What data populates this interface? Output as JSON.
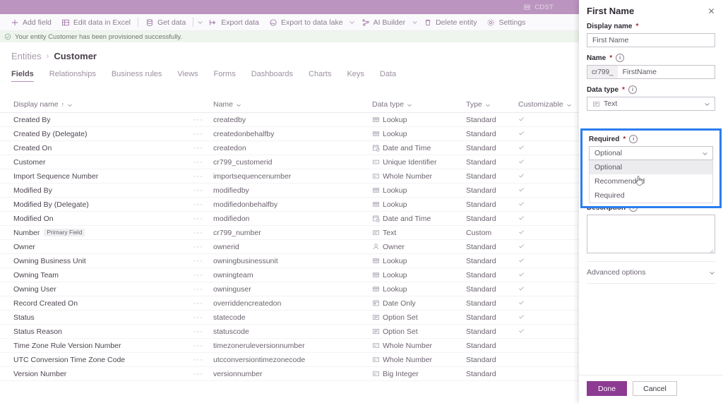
{
  "appbar": {
    "env_label": "CDST",
    "env_icon": "server-icon"
  },
  "commandbar": {
    "items": [
      {
        "label": "Add field",
        "icon": "plus-icon",
        "caret": false
      },
      {
        "label": "Edit data in Excel",
        "icon": "excel-icon",
        "caret": false
      },
      {
        "label": "Get data",
        "icon": "database-icon",
        "caret": true
      },
      {
        "label": "Export data",
        "icon": "export-icon",
        "caret": false
      },
      {
        "label": "Export to data lake",
        "icon": "datalake-icon",
        "caret": true
      },
      {
        "label": "AI Builder",
        "icon": "ai-builder-icon",
        "caret": true
      },
      {
        "label": "Delete entity",
        "icon": "trash-icon",
        "caret": false
      },
      {
        "label": "Settings",
        "icon": "gear-icon",
        "caret": false
      }
    ]
  },
  "notification": {
    "text": "Your entity Customer has been provisioned successfully.",
    "icon": "check-circle-icon"
  },
  "breadcrumb": {
    "parent": "Entities",
    "separator": "›",
    "current": "Customer"
  },
  "tabs": [
    {
      "label": "Fields",
      "active": true
    },
    {
      "label": "Relationships",
      "active": false
    },
    {
      "label": "Business rules",
      "active": false
    },
    {
      "label": "Views",
      "active": false
    },
    {
      "label": "Forms",
      "active": false
    },
    {
      "label": "Dashboards",
      "active": false
    },
    {
      "label": "Charts",
      "active": false
    },
    {
      "label": "Keys",
      "active": false
    },
    {
      "label": "Data",
      "active": false
    }
  ],
  "grid": {
    "columns": [
      {
        "label": "Display name",
        "sort": "↑"
      },
      {
        "label": "Name",
        "sort": ""
      },
      {
        "label": "Data type",
        "sort": ""
      },
      {
        "label": "Type",
        "sort": ""
      },
      {
        "label": "Customizable",
        "sort": ""
      }
    ],
    "dots": "···",
    "check": "✓",
    "rows": [
      {
        "display": "Created By",
        "badge": "",
        "name": "createdby",
        "datatype": "Lookup",
        "dticon": "lookup-icon",
        "type": "Standard",
        "customizable": true
      },
      {
        "display": "Created By (Delegate)",
        "badge": "",
        "name": "createdonbehalfby",
        "datatype": "Lookup",
        "dticon": "lookup-icon",
        "type": "Standard",
        "customizable": true
      },
      {
        "display": "Created On",
        "badge": "",
        "name": "createdon",
        "datatype": "Date and Time",
        "dticon": "datetime-icon",
        "type": "Standard",
        "customizable": true
      },
      {
        "display": "Customer",
        "badge": "",
        "name": "cr799_customerid",
        "datatype": "Unique Identifier",
        "dticon": "guid-icon",
        "type": "Standard",
        "customizable": true
      },
      {
        "display": "Import Sequence Number",
        "badge": "",
        "name": "importsequencenumber",
        "datatype": "Whole Number",
        "dticon": "number-icon",
        "type": "Standard",
        "customizable": true
      },
      {
        "display": "Modified By",
        "badge": "",
        "name": "modifiedby",
        "datatype": "Lookup",
        "dticon": "lookup-icon",
        "type": "Standard",
        "customizable": true
      },
      {
        "display": "Modified By (Delegate)",
        "badge": "",
        "name": "modifiedonbehalfby",
        "datatype": "Lookup",
        "dticon": "lookup-icon",
        "type": "Standard",
        "customizable": true
      },
      {
        "display": "Modified On",
        "badge": "",
        "name": "modifiedon",
        "datatype": "Date and Time",
        "dticon": "datetime-icon",
        "type": "Standard",
        "customizable": true
      },
      {
        "display": "Number",
        "badge": "Primary Field",
        "name": "cr799_number",
        "datatype": "Text",
        "dticon": "text-icon",
        "type": "Custom",
        "customizable": true
      },
      {
        "display": "Owner",
        "badge": "",
        "name": "ownerid",
        "datatype": "Owner",
        "dticon": "person-icon",
        "type": "Standard",
        "customizable": true
      },
      {
        "display": "Owning Business Unit",
        "badge": "",
        "name": "owningbusinessunit",
        "datatype": "Lookup",
        "dticon": "lookup-icon",
        "type": "Standard",
        "customizable": true
      },
      {
        "display": "Owning Team",
        "badge": "",
        "name": "owningteam",
        "datatype": "Lookup",
        "dticon": "lookup-icon",
        "type": "Standard",
        "customizable": true
      },
      {
        "display": "Owning User",
        "badge": "",
        "name": "owninguser",
        "datatype": "Lookup",
        "dticon": "lookup-icon",
        "type": "Standard",
        "customizable": true
      },
      {
        "display": "Record Created On",
        "badge": "",
        "name": "overriddencreatedon",
        "datatype": "Date Only",
        "dticon": "dateonly-icon",
        "type": "Standard",
        "customizable": true
      },
      {
        "display": "Status",
        "badge": "",
        "name": "statecode",
        "datatype": "Option Set",
        "dticon": "optionset-icon",
        "type": "Standard",
        "customizable": true
      },
      {
        "display": "Status Reason",
        "badge": "",
        "name": "statuscode",
        "datatype": "Option Set",
        "dticon": "optionset-icon",
        "type": "Standard",
        "customizable": true
      },
      {
        "display": "Time Zone Rule Version Number",
        "badge": "",
        "name": "timezoneruleversionnumber",
        "datatype": "Whole Number",
        "dticon": "number-icon",
        "type": "Standard",
        "customizable": false
      },
      {
        "display": "UTC Conversion Time Zone Code",
        "badge": "",
        "name": "utcconversiontimezonecode",
        "datatype": "Whole Number",
        "dticon": "number-icon",
        "type": "Standard",
        "customizable": false
      },
      {
        "display": "Version Number",
        "badge": "",
        "name": "versionnumber",
        "datatype": "Big Integer",
        "dticon": "number-icon",
        "type": "Standard",
        "customizable": false
      }
    ]
  },
  "panel": {
    "title": "First Name",
    "close_label": "✕",
    "display_name": {
      "label": "Display name",
      "required_mark": "*",
      "value": "First Name"
    },
    "name": {
      "label": "Name",
      "required_mark": "*",
      "prefix": "cr799_",
      "value": "FirstName",
      "info": "ⓘ"
    },
    "data_type": {
      "label": "Data type",
      "required_mark": "*",
      "value": "Text",
      "icon": "text-icon"
    },
    "required": {
      "label": "Required",
      "required_mark": "*",
      "value": "Optional",
      "options": [
        "Optional",
        "Recommended",
        "Required"
      ],
      "selected_index": 0,
      "hovered_index": 1,
      "highlight_color": "#2a7ef0"
    },
    "description": {
      "label": "Description",
      "value": ""
    },
    "advanced_options": {
      "label": "Advanced options"
    },
    "footer": {
      "done_label": "Done",
      "cancel_label": "Cancel",
      "done_color": "#8c3a92"
    },
    "info_glyph": "i"
  }
}
